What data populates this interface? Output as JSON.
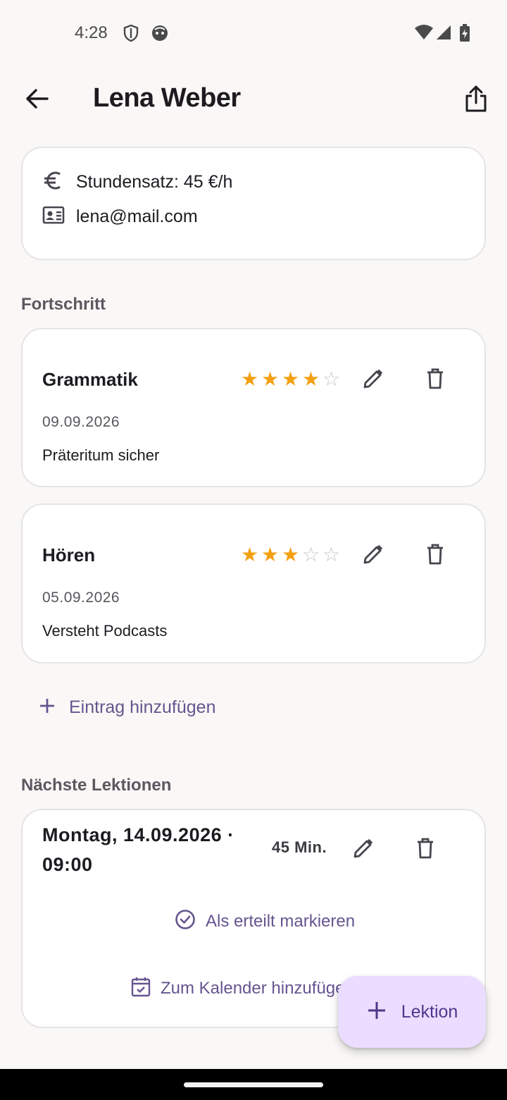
{
  "status_bar": {
    "time": "4:28",
    "icons": [
      "shield-icon",
      "face-icon",
      "wifi-icon",
      "signal-icon",
      "battery-charging-icon"
    ]
  },
  "app_bar": {
    "title": "Lena Weber",
    "back_icon": "arrow-back-icon",
    "share_icon": "share-icon"
  },
  "info": {
    "rate": "Stundensatz: 45 €/h",
    "email": "lena@mail.com"
  },
  "progress": {
    "section_title": "Fortschritt",
    "entries": [
      {
        "title": "Grammatik",
        "rating": 4,
        "max_rating": 5,
        "date": "09.09.2026",
        "note": "Präteritum sicher"
      },
      {
        "title": "Hören",
        "rating": 3,
        "max_rating": 5,
        "date": "05.09.2026",
        "note": "Versteht Podcasts"
      }
    ],
    "add_label": "Eintrag hinzufügen"
  },
  "lessons": {
    "section_title": "Nächste Lektionen",
    "items": [
      {
        "date_time": "Montag, 14.09.2026 · 09:00",
        "duration": "45 Min.",
        "mark_done_label": "Als erteilt markieren",
        "calendar_label": "Zum Kalender hinzufügen"
      }
    ]
  },
  "fab": {
    "label": "Lektion"
  },
  "colors": {
    "background": "#f9f8f6",
    "accent": "#65558f",
    "star": "#f4a013",
    "fab_bg": "#eaddff"
  }
}
